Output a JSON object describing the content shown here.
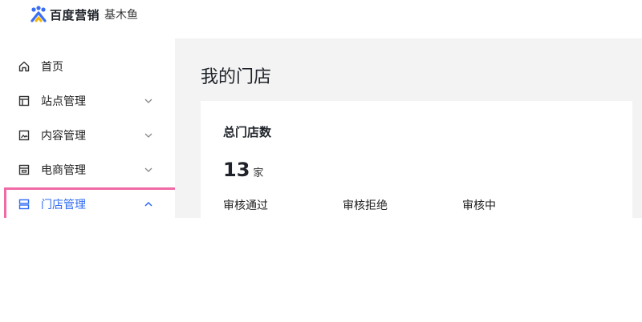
{
  "header": {
    "brand": "百度营销",
    "product": "基木鱼"
  },
  "sidebar": {
    "items": [
      {
        "label": "首页",
        "icon": "home-icon",
        "expandable": false
      },
      {
        "label": "站点管理",
        "icon": "layout-icon",
        "expandable": true,
        "expanded": false
      },
      {
        "label": "内容管理",
        "icon": "image-icon",
        "expandable": true,
        "expanded": false
      },
      {
        "label": "电商管理",
        "icon": "shop-icon",
        "expandable": true,
        "expanded": false
      },
      {
        "label": "门店管理",
        "icon": "store-icon",
        "expandable": true,
        "expanded": true,
        "active": true
      }
    ]
  },
  "main": {
    "title": "我的门店",
    "card": {
      "title": "总门店数",
      "count": "13",
      "unit": "家",
      "stats": [
        "审核通过",
        "审核拒绝",
        "审核中"
      ]
    }
  },
  "colors": {
    "accent": "#2f6bf2",
    "highlight_border": "#ef6aa6",
    "main_bg": "#f3f3f3"
  }
}
